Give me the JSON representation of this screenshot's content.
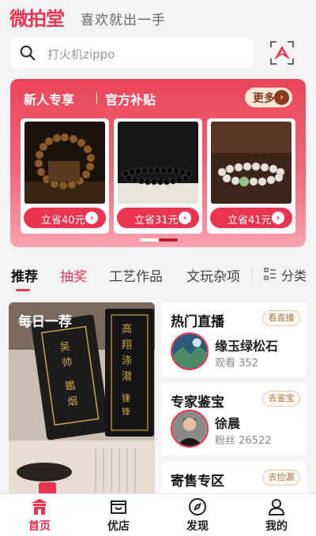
{
  "header": {
    "logo": "微拍堂",
    "slogan": "喜欢就出一手"
  },
  "search": {
    "placeholder": "打火机zippo"
  },
  "banner": {
    "title": "新人专享",
    "subtitle": "官方补贴",
    "more_label": "更多",
    "cards": [
      {
        "save_label": "立省40元"
      },
      {
        "save_label": "立省31元"
      },
      {
        "save_label": "立省41元"
      }
    ]
  },
  "tabs": {
    "items": [
      "推荐",
      "抽奖",
      "工艺作品",
      "文玩杂项"
    ],
    "category_label": "分类",
    "active_index": 0
  },
  "daily": {
    "label": "每日一荐"
  },
  "live": {
    "title": "热门直播",
    "button": "看直播",
    "name": "缘玉绿松石",
    "meta": "观看 352"
  },
  "expert": {
    "title": "专家鉴宝",
    "button": "去鉴宝",
    "name": "徐晨",
    "meta": "粉丝 26522"
  },
  "consign": {
    "title": "寄售专区",
    "button": "去捡漏"
  },
  "bottom_nav": {
    "items": [
      {
        "label": "首页",
        "icon": "home-icon",
        "active": true
      },
      {
        "label": "优店",
        "icon": "shop-icon",
        "active": false
      },
      {
        "label": "发现",
        "icon": "compass-icon",
        "active": false
      },
      {
        "label": "我的",
        "icon": "user-icon",
        "active": false
      }
    ]
  },
  "colors": {
    "accent": "#e8344e",
    "background": "#f4f4f6"
  }
}
